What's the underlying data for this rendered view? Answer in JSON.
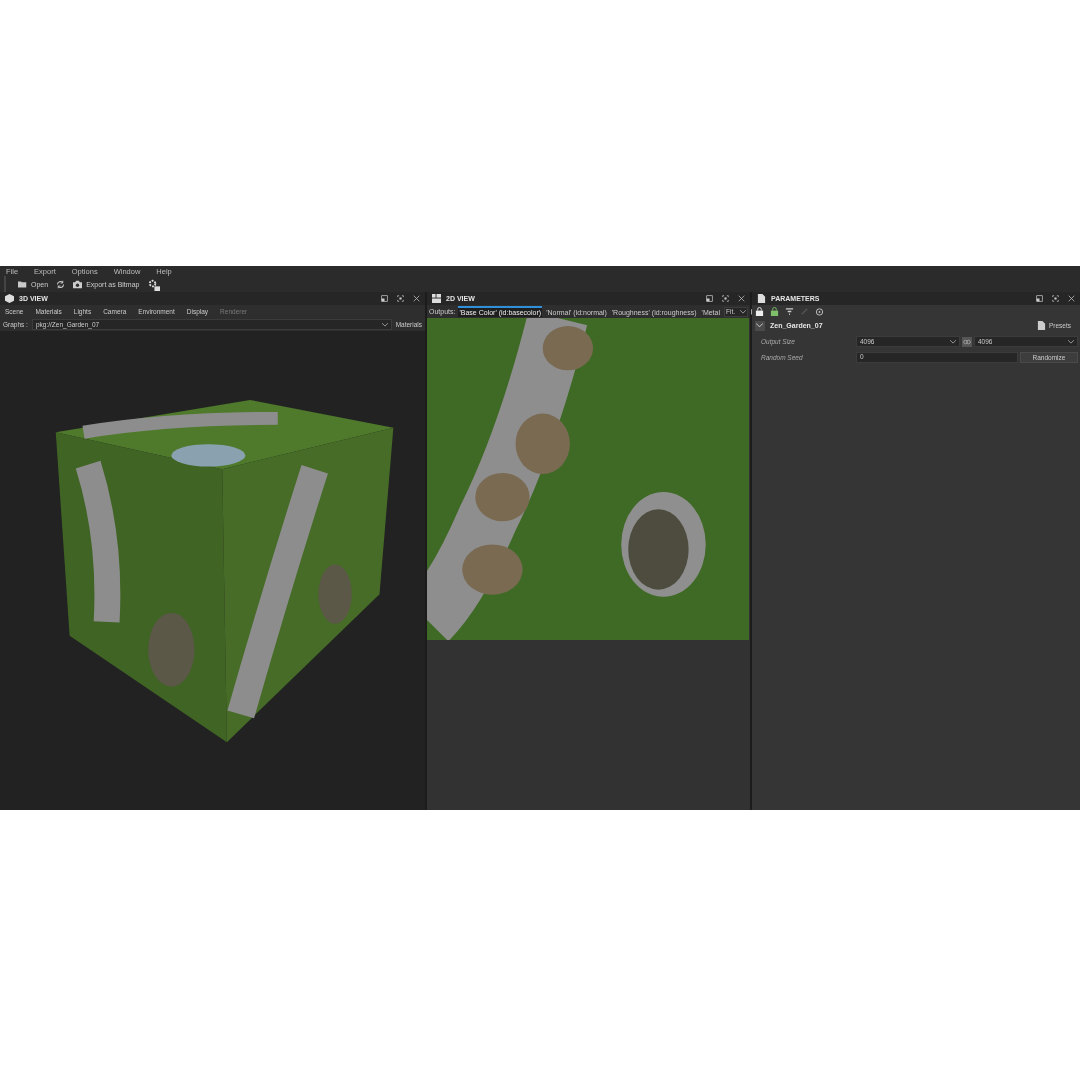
{
  "menu": [
    "File",
    "Export",
    "Options",
    "Window",
    "Help"
  ],
  "toolbar": [
    {
      "kind": "open",
      "label": "Open"
    },
    {
      "kind": "refresh"
    },
    {
      "kind": "export",
      "label": "Export as Bitmap"
    },
    {
      "kind": "settings"
    }
  ],
  "view3d": {
    "title": "3D VIEW",
    "tabs": [
      {
        "label": "Scene",
        "disabled": false
      },
      {
        "label": "Materials",
        "disabled": false
      },
      {
        "label": "Lights",
        "disabled": false
      },
      {
        "label": "Camera",
        "disabled": false
      },
      {
        "label": "Environment",
        "disabled": false
      },
      {
        "label": "Display",
        "disabled": false
      },
      {
        "label": "Renderer",
        "disabled": true
      }
    ],
    "graphs_label": "Graphs :",
    "graph_value": "pkg://Zen_Garden_07",
    "materials": "Materials"
  },
  "view2d": {
    "title": "2D VIEW",
    "outputs_label": "Outputs:",
    "tabs": [
      {
        "label": "'Base Color' (id:basecolor)",
        "selected": true
      },
      {
        "label": "'Normal' (id:normal)",
        "selected": false
      },
      {
        "label": "'Roughness' (id:roughness)",
        "selected": false
      },
      {
        "label": "'Metal",
        "selected": false
      }
    ],
    "zoom_value": "Fit."
  },
  "parameters": {
    "title": "PARAMETERS",
    "graph_name": "Zen_Garden_07",
    "expanded": true,
    "presets": "Presets",
    "rows": [
      {
        "kind": "size",
        "label": "Output Size",
        "value": "4096",
        "value2": "4096"
      },
      {
        "kind": "seed",
        "label": "Random Seed",
        "value": "0",
        "button": "Randomize"
      }
    ]
  }
}
